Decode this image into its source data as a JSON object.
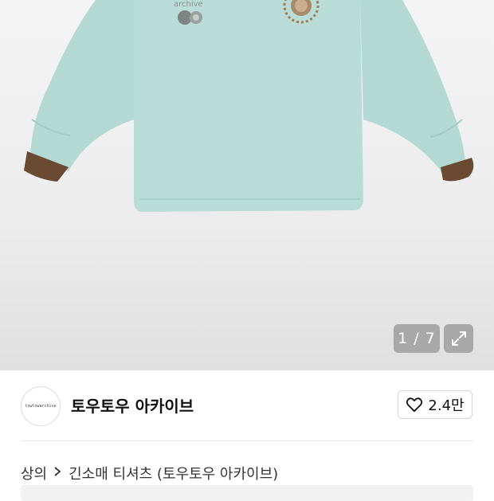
{
  "gallery": {
    "counter": "1 / 7",
    "expand_icon": "expand-icon",
    "print_text": "archive"
  },
  "shop": {
    "avatar_text": "towtowarchive",
    "name": "토우토우 아카이브",
    "like_icon": "heart-icon",
    "like_count": "2.4만"
  },
  "breadcrumb": {
    "items": [
      "상의",
      "긴소매 티셔츠 (토우토우 아카이브)"
    ],
    "separator_icon": "chevron-right-icon"
  },
  "colors": {
    "shirt": "#b9ddd6",
    "cuff": "#6b4a33",
    "print": "#9a7a5a"
  }
}
